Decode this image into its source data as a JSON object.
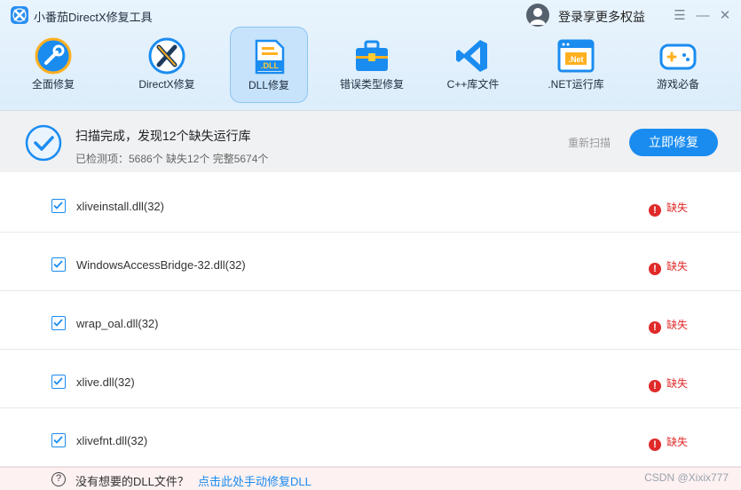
{
  "window": {
    "title": "小番茄DirectX修复工具",
    "login_text": "登录享更多权益",
    "menu_glyph": "☰",
    "minimize_glyph": "—",
    "close_glyph": "✕"
  },
  "tabs": [
    {
      "label": "全面修复",
      "icon": "wrench-icon"
    },
    {
      "label": "DirectX修复",
      "icon": "directx-icon"
    },
    {
      "label": "DLL修复",
      "icon": "dll-file-icon",
      "active": true
    },
    {
      "label": "错误类型修复",
      "icon": "toolbox-icon"
    },
    {
      "label": "C++库文件",
      "icon": "vscode-icon"
    },
    {
      "label": ".NET运行库",
      "icon": "dotnet-icon"
    },
    {
      "label": "游戏必备",
      "icon": "gamepad-icon"
    }
  ],
  "icon_text": {
    "dll": ".DLL",
    "net": ".Net"
  },
  "scan": {
    "title": "扫描完成，发现12个缺失运行库",
    "stats": "已检测项：5686个 缺失12个 完整5674个",
    "rescan_label": "重新扫描",
    "fix_label": "立即修复"
  },
  "files": [
    {
      "name": "xliveinstall.dll(32)",
      "status": "缺失"
    },
    {
      "name": "WindowsAccessBridge-32.dll(32)",
      "status": "缺失"
    },
    {
      "name": "wrap_oal.dll(32)",
      "status": "缺失"
    },
    {
      "name": "xlive.dll(32)",
      "status": "缺失"
    },
    {
      "name": "xlivefnt.dll(32)",
      "status": "缺失"
    }
  ],
  "footer": {
    "question": "没有想要的DLL文件？",
    "link": "点击此处手动修复DLL",
    "watermark": "CSDN @Xixix777"
  },
  "colors": {
    "accent": "#1a8cf0",
    "missing": "#e02a2a",
    "header_bg": "#e4f1fc"
  }
}
